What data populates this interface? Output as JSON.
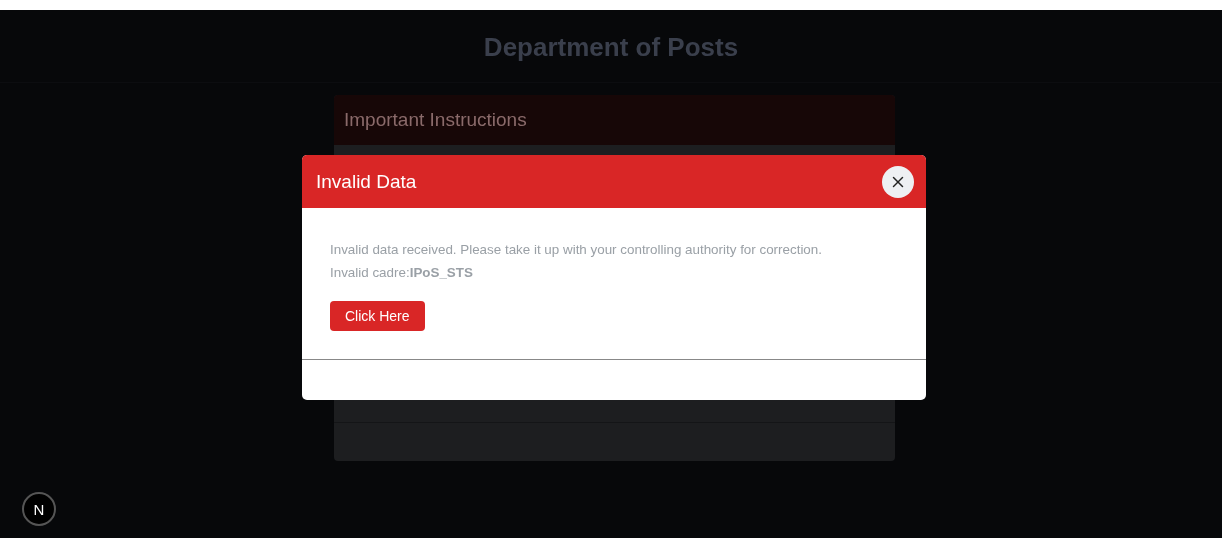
{
  "header": {
    "title": "Department of Posts"
  },
  "background_dialog": {
    "title": "Important Instructions"
  },
  "dialog": {
    "title": "Invalid Data",
    "message": "Invalid data received. Please take it up with your controlling authority for correction.",
    "detail": "Invalid cadre:**IPoS_STS**",
    "button": "Click Here"
  },
  "badge": "N"
}
